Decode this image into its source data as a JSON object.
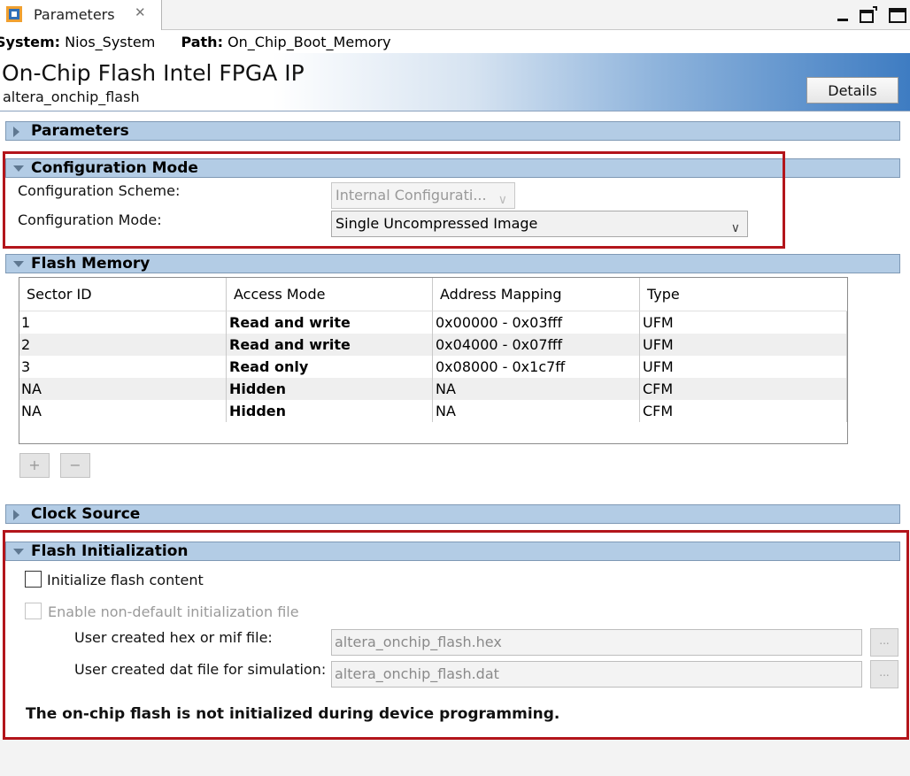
{
  "tab": {
    "label": "Parameters",
    "close_glyph": "✕"
  },
  "window_controls": [
    "minimize-icon",
    "restore-icon",
    "maximize-icon"
  ],
  "path_bar": {
    "system_label": "System:",
    "system_value": "Nios_System",
    "path_label": "Path:",
    "path_value": "On_Chip_Boot_Memory"
  },
  "header": {
    "title": "On-Chip Flash Intel FPGA IP",
    "name": "altera_onchip_flash",
    "details_label": "Details"
  },
  "sections": {
    "parameters": "Parameters",
    "configuration_mode": "Configuration Mode",
    "flash_memory": "Flash Memory",
    "clock_source": "Clock Source",
    "flash_initialization": "Flash Initialization"
  },
  "configuration": {
    "scheme_label": "Configuration Scheme:",
    "scheme_value": "Internal Configurati...",
    "mode_label": "Configuration Mode:",
    "mode_value": "Single Uncompressed Image"
  },
  "flash_memory": {
    "columns": [
      "Sector ID",
      "Access Mode",
      "Address Mapping",
      "Type"
    ],
    "rows": [
      [
        "1",
        "Read and write",
        "0x00000 - 0x03fff",
        "UFM"
      ],
      [
        "2",
        "Read and write",
        "0x04000 - 0x07fff",
        "UFM"
      ],
      [
        "3",
        "Read only",
        "0x08000 - 0x1c7ff",
        "UFM"
      ],
      [
        "NA",
        "Hidden",
        "NA",
        "CFM"
      ],
      [
        "NA",
        "Hidden",
        "NA",
        "CFM"
      ]
    ],
    "add_label": "+",
    "remove_label": "−"
  },
  "flash_init": {
    "initialize_label": "Initialize flash content",
    "initialize_checked": false,
    "nondefault_label": "Enable non-default initialization file",
    "nondefault_checked": false,
    "hex_label": "User created hex or mif file:",
    "hex_value": "altera_onchip_flash.hex",
    "dat_label": "User created dat file for simulation:",
    "dat_value": "altera_onchip_flash.dat",
    "browse_label": "...",
    "note": "The on-chip flash is not initialized during device programming."
  },
  "colors": {
    "section_bg": "#b3cce5",
    "highlight_box": "#b3151b",
    "banner_blue": "#3e7cc2"
  }
}
